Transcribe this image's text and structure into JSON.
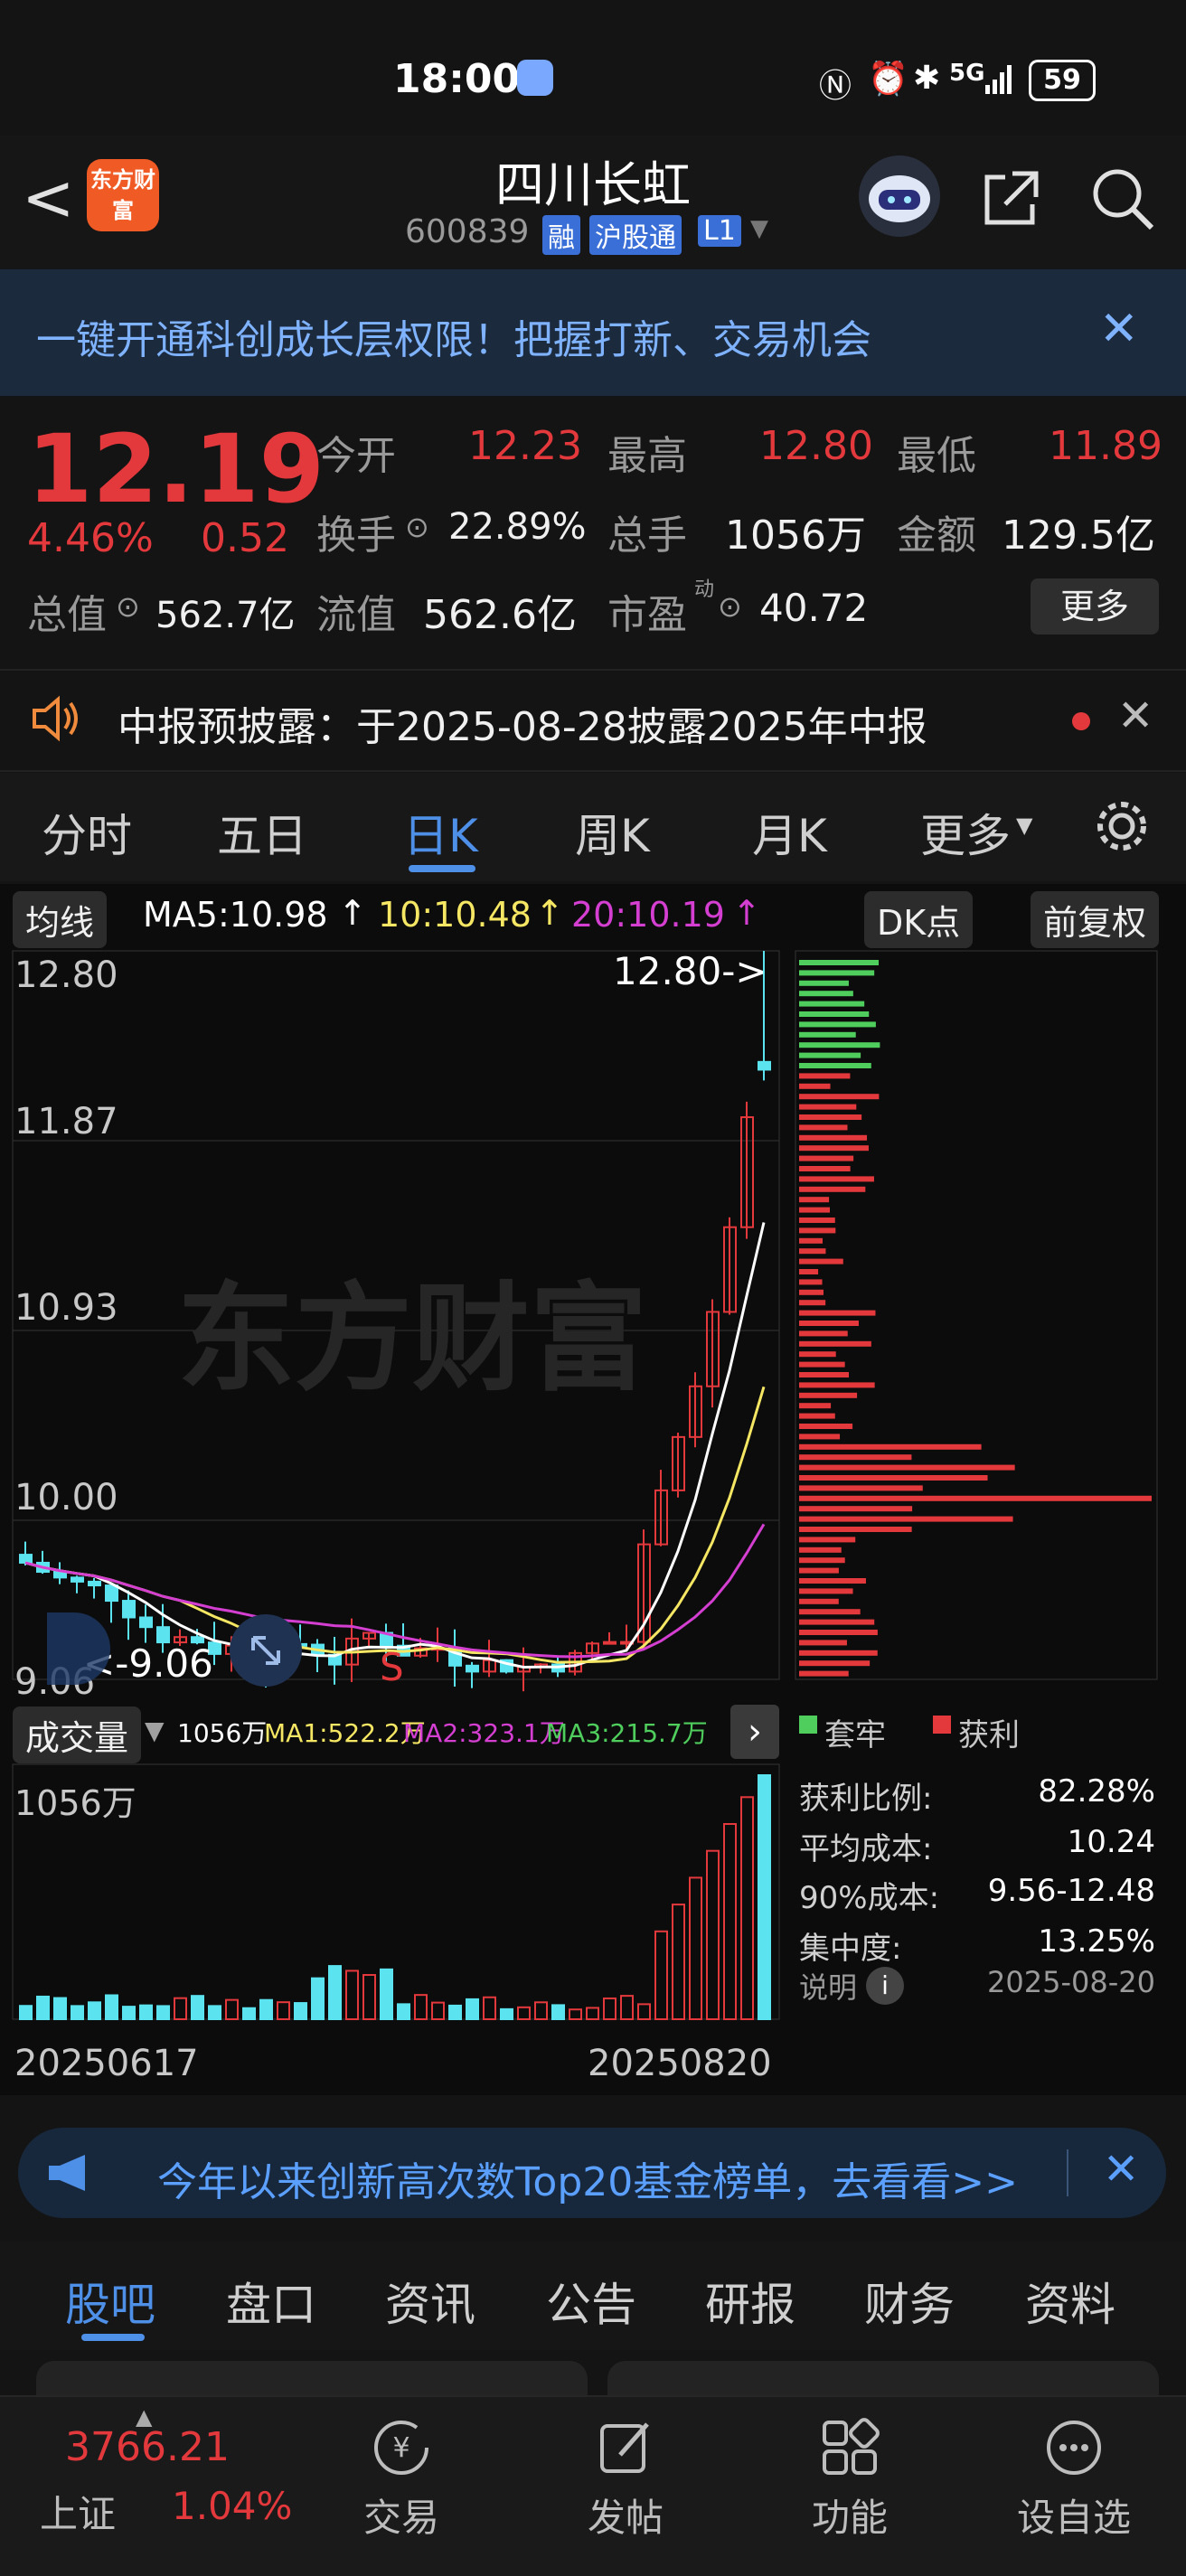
{
  "status_bar": {
    "time": "18:00",
    "battery": "59",
    "network": "5G"
  },
  "header": {
    "title": "四川长虹",
    "code": "600839",
    "tag_rong": "融",
    "tag_hgt": "沪股通",
    "tag_level": "L1",
    "back_label": "<",
    "logo_text": "东方财富"
  },
  "banner": {
    "text": "一键开通科创成长层权限！把握打新、交易机会"
  },
  "quote": {
    "price": "12.19",
    "change_pct": "4.46%",
    "change": "0.52",
    "open_label": "今开",
    "open": "12.23",
    "high_label": "最高",
    "high": "12.80",
    "low_label": "最低",
    "low": "11.89",
    "turnover_label": "换手",
    "turnover": "22.89%",
    "volume_label": "总手",
    "volume": "1056万",
    "amount_label": "金额",
    "amount": "129.5亿",
    "mktcap_label": "总值",
    "mktcap": "562.7亿",
    "float_label": "流值",
    "float": "562.6亿",
    "pe_label": "市盈",
    "pe_sup": "动",
    "pe": "40.72",
    "more_label": "更多"
  },
  "notice": {
    "text": "中报预披露：于2025-08-28披露2025年中报"
  },
  "tabs": [
    "分时",
    "五日",
    "日K",
    "周K",
    "月K",
    "更多"
  ],
  "active_tab": "日K",
  "kline": {
    "ma_label": "均线",
    "ma5": "MA5:10.98",
    "ma10": "10:10.48",
    "ma20": "20:10.19",
    "dk_label": "DK点",
    "fq_label": "前复权",
    "y_labels": [
      "12.80",
      "11.87",
      "10.93",
      "10.00",
      "9.06"
    ],
    "high_marker": "12.80->",
    "low_marker": "<-9.06",
    "s_marker": "S",
    "watermark": "东方财富",
    "vol_label": "成交量",
    "vol_value": "1056万",
    "vol_ma1": "MA1:522.2万",
    "vol_ma2": "MA2:323.1万",
    "vol_ma3": "MA3:215.7万",
    "vol_ymax": "1056万",
    "date_start": "20250617",
    "date_end": "20250820"
  },
  "chip": {
    "legend_trap": "套牢",
    "legend_profit": "获利",
    "rows": [
      {
        "label": "获利比例:",
        "value": "82.28%"
      },
      {
        "label": "平均成本:",
        "value": "10.24"
      },
      {
        "label": "90%成本:",
        "value": "9.56-12.48"
      },
      {
        "label": "集中度:",
        "value": "13.25%"
      }
    ],
    "note_label": "说明",
    "date": "2025-08-20"
  },
  "ad": {
    "text": "今年以来创新高次数Top20基金榜单，去看看>>"
  },
  "bottom_tabs": [
    "股吧",
    "盘口",
    "资讯",
    "公告",
    "研报",
    "财务",
    "资料"
  ],
  "nav": {
    "index_value": "3766.21",
    "index_name": "上证",
    "index_pct": "1.04%",
    "items": [
      "交易",
      "发帖",
      "功能",
      "设自选"
    ]
  },
  "colors": {
    "up": "#e4393c",
    "down": "#5be4f0",
    "accent": "#4e8fe8",
    "ma5": "#ffffff",
    "ma10": "#f5e663",
    "ma20": "#d43fd1"
  }
}
